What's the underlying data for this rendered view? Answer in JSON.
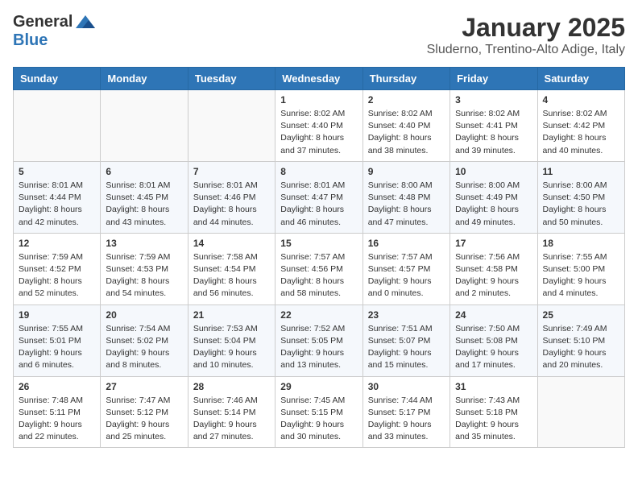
{
  "header": {
    "logo_general": "General",
    "logo_blue": "Blue",
    "month": "January 2025",
    "location": "Sluderno, Trentino-Alto Adige, Italy"
  },
  "weekdays": [
    "Sunday",
    "Monday",
    "Tuesday",
    "Wednesday",
    "Thursday",
    "Friday",
    "Saturday"
  ],
  "weeks": [
    [
      {
        "day": "",
        "sunrise": "",
        "sunset": "",
        "daylight": ""
      },
      {
        "day": "",
        "sunrise": "",
        "sunset": "",
        "daylight": ""
      },
      {
        "day": "",
        "sunrise": "",
        "sunset": "",
        "daylight": ""
      },
      {
        "day": "1",
        "sunrise": "Sunrise: 8:02 AM",
        "sunset": "Sunset: 4:40 PM",
        "daylight": "Daylight: 8 hours and 37 minutes."
      },
      {
        "day": "2",
        "sunrise": "Sunrise: 8:02 AM",
        "sunset": "Sunset: 4:40 PM",
        "daylight": "Daylight: 8 hours and 38 minutes."
      },
      {
        "day": "3",
        "sunrise": "Sunrise: 8:02 AM",
        "sunset": "Sunset: 4:41 PM",
        "daylight": "Daylight: 8 hours and 39 minutes."
      },
      {
        "day": "4",
        "sunrise": "Sunrise: 8:02 AM",
        "sunset": "Sunset: 4:42 PM",
        "daylight": "Daylight: 8 hours and 40 minutes."
      }
    ],
    [
      {
        "day": "5",
        "sunrise": "Sunrise: 8:01 AM",
        "sunset": "Sunset: 4:44 PM",
        "daylight": "Daylight: 8 hours and 42 minutes."
      },
      {
        "day": "6",
        "sunrise": "Sunrise: 8:01 AM",
        "sunset": "Sunset: 4:45 PM",
        "daylight": "Daylight: 8 hours and 43 minutes."
      },
      {
        "day": "7",
        "sunrise": "Sunrise: 8:01 AM",
        "sunset": "Sunset: 4:46 PM",
        "daylight": "Daylight: 8 hours and 44 minutes."
      },
      {
        "day": "8",
        "sunrise": "Sunrise: 8:01 AM",
        "sunset": "Sunset: 4:47 PM",
        "daylight": "Daylight: 8 hours and 46 minutes."
      },
      {
        "day": "9",
        "sunrise": "Sunrise: 8:00 AM",
        "sunset": "Sunset: 4:48 PM",
        "daylight": "Daylight: 8 hours and 47 minutes."
      },
      {
        "day": "10",
        "sunrise": "Sunrise: 8:00 AM",
        "sunset": "Sunset: 4:49 PM",
        "daylight": "Daylight: 8 hours and 49 minutes."
      },
      {
        "day": "11",
        "sunrise": "Sunrise: 8:00 AM",
        "sunset": "Sunset: 4:50 PM",
        "daylight": "Daylight: 8 hours and 50 minutes."
      }
    ],
    [
      {
        "day": "12",
        "sunrise": "Sunrise: 7:59 AM",
        "sunset": "Sunset: 4:52 PM",
        "daylight": "Daylight: 8 hours and 52 minutes."
      },
      {
        "day": "13",
        "sunrise": "Sunrise: 7:59 AM",
        "sunset": "Sunset: 4:53 PM",
        "daylight": "Daylight: 8 hours and 54 minutes."
      },
      {
        "day": "14",
        "sunrise": "Sunrise: 7:58 AM",
        "sunset": "Sunset: 4:54 PM",
        "daylight": "Daylight: 8 hours and 56 minutes."
      },
      {
        "day": "15",
        "sunrise": "Sunrise: 7:57 AM",
        "sunset": "Sunset: 4:56 PM",
        "daylight": "Daylight: 8 hours and 58 minutes."
      },
      {
        "day": "16",
        "sunrise": "Sunrise: 7:57 AM",
        "sunset": "Sunset: 4:57 PM",
        "daylight": "Daylight: 9 hours and 0 minutes."
      },
      {
        "day": "17",
        "sunrise": "Sunrise: 7:56 AM",
        "sunset": "Sunset: 4:58 PM",
        "daylight": "Daylight: 9 hours and 2 minutes."
      },
      {
        "day": "18",
        "sunrise": "Sunrise: 7:55 AM",
        "sunset": "Sunset: 5:00 PM",
        "daylight": "Daylight: 9 hours and 4 minutes."
      }
    ],
    [
      {
        "day": "19",
        "sunrise": "Sunrise: 7:55 AM",
        "sunset": "Sunset: 5:01 PM",
        "daylight": "Daylight: 9 hours and 6 minutes."
      },
      {
        "day": "20",
        "sunrise": "Sunrise: 7:54 AM",
        "sunset": "Sunset: 5:02 PM",
        "daylight": "Daylight: 9 hours and 8 minutes."
      },
      {
        "day": "21",
        "sunrise": "Sunrise: 7:53 AM",
        "sunset": "Sunset: 5:04 PM",
        "daylight": "Daylight: 9 hours and 10 minutes."
      },
      {
        "day": "22",
        "sunrise": "Sunrise: 7:52 AM",
        "sunset": "Sunset: 5:05 PM",
        "daylight": "Daylight: 9 hours and 13 minutes."
      },
      {
        "day": "23",
        "sunrise": "Sunrise: 7:51 AM",
        "sunset": "Sunset: 5:07 PM",
        "daylight": "Daylight: 9 hours and 15 minutes."
      },
      {
        "day": "24",
        "sunrise": "Sunrise: 7:50 AM",
        "sunset": "Sunset: 5:08 PM",
        "daylight": "Daylight: 9 hours and 17 minutes."
      },
      {
        "day": "25",
        "sunrise": "Sunrise: 7:49 AM",
        "sunset": "Sunset: 5:10 PM",
        "daylight": "Daylight: 9 hours and 20 minutes."
      }
    ],
    [
      {
        "day": "26",
        "sunrise": "Sunrise: 7:48 AM",
        "sunset": "Sunset: 5:11 PM",
        "daylight": "Daylight: 9 hours and 22 minutes."
      },
      {
        "day": "27",
        "sunrise": "Sunrise: 7:47 AM",
        "sunset": "Sunset: 5:12 PM",
        "daylight": "Daylight: 9 hours and 25 minutes."
      },
      {
        "day": "28",
        "sunrise": "Sunrise: 7:46 AM",
        "sunset": "Sunset: 5:14 PM",
        "daylight": "Daylight: 9 hours and 27 minutes."
      },
      {
        "day": "29",
        "sunrise": "Sunrise: 7:45 AM",
        "sunset": "Sunset: 5:15 PM",
        "daylight": "Daylight: 9 hours and 30 minutes."
      },
      {
        "day": "30",
        "sunrise": "Sunrise: 7:44 AM",
        "sunset": "Sunset: 5:17 PM",
        "daylight": "Daylight: 9 hours and 33 minutes."
      },
      {
        "day": "31",
        "sunrise": "Sunrise: 7:43 AM",
        "sunset": "Sunset: 5:18 PM",
        "daylight": "Daylight: 9 hours and 35 minutes."
      },
      {
        "day": "",
        "sunrise": "",
        "sunset": "",
        "daylight": ""
      }
    ]
  ]
}
